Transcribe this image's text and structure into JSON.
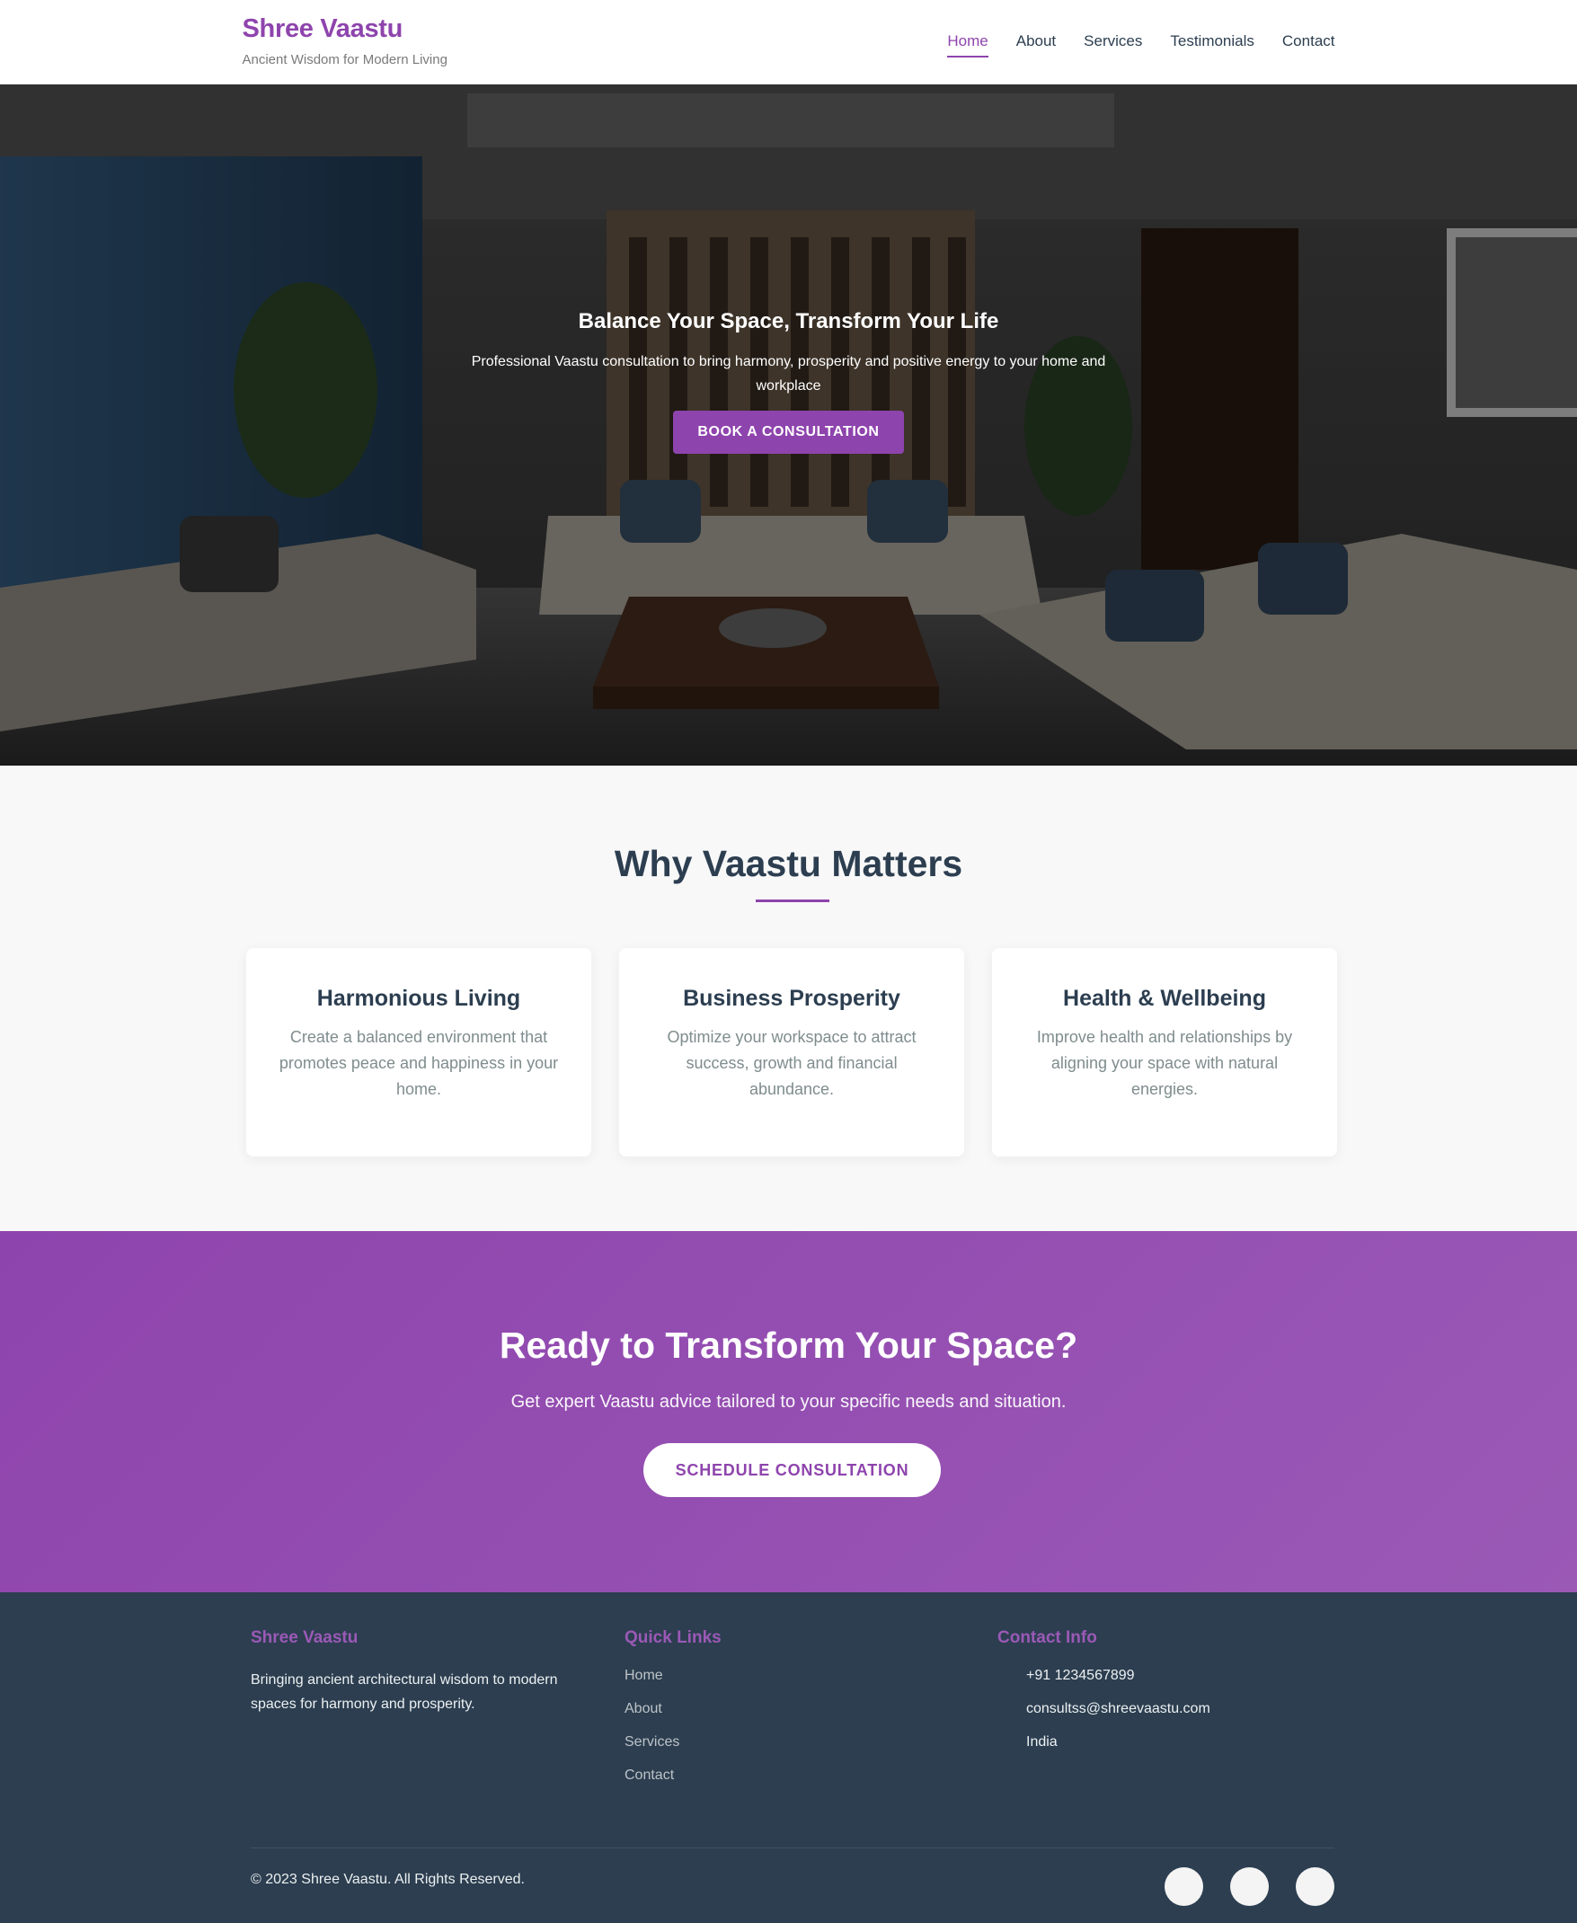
{
  "brand": {
    "name": "Shree Vaastu",
    "tagline": "Ancient Wisdom for Modern Living"
  },
  "nav": {
    "items": [
      {
        "label": "Home",
        "active": true
      },
      {
        "label": "About"
      },
      {
        "label": "Services"
      },
      {
        "label": "Testimonials"
      },
      {
        "label": "Contact"
      }
    ]
  },
  "hero": {
    "title": "Balance Your Space, Transform Your Life",
    "subtitle": "Professional Vaastu consultation to bring harmony, prosperity and positive energy to your home and workplace",
    "button_label": "BOOK A CONSULTATION"
  },
  "why": {
    "title": "Why Vaastu Matters",
    "cards": [
      {
        "title": "Harmonious Living",
        "text": "Create a balanced environment that promotes peace and happiness in your home."
      },
      {
        "title": "Business Prosperity",
        "text": "Optimize your workspace to attract success, growth and financial abundance."
      },
      {
        "title": "Health & Wellbeing",
        "text": "Improve health and relationships by aligning your space with natural energies."
      }
    ]
  },
  "cta": {
    "title": "Ready to Transform Your Space?",
    "subtitle": "Get expert Vaastu advice tailored to your specific needs and situation.",
    "button_label": "SCHEDULE CONSULTATION"
  },
  "footer": {
    "about": {
      "heading": "Shree Vaastu",
      "text": "Bringing ancient architectural wisdom to modern spaces for harmony and prosperity."
    },
    "links": {
      "heading": "Quick Links",
      "items": [
        "Home",
        "About",
        "Services",
        "Contact"
      ]
    },
    "contact": {
      "heading": "Contact Info",
      "phone": "+91 1234567899",
      "email": "consultss@shreevaastu.com",
      "location": "India"
    },
    "copyright": "© 2023 Shree Vaastu. All Rights Reserved."
  },
  "colors": {
    "brand": "#8e44ad",
    "dark": "#2c3e50",
    "light_bg": "#f8f8f8"
  }
}
